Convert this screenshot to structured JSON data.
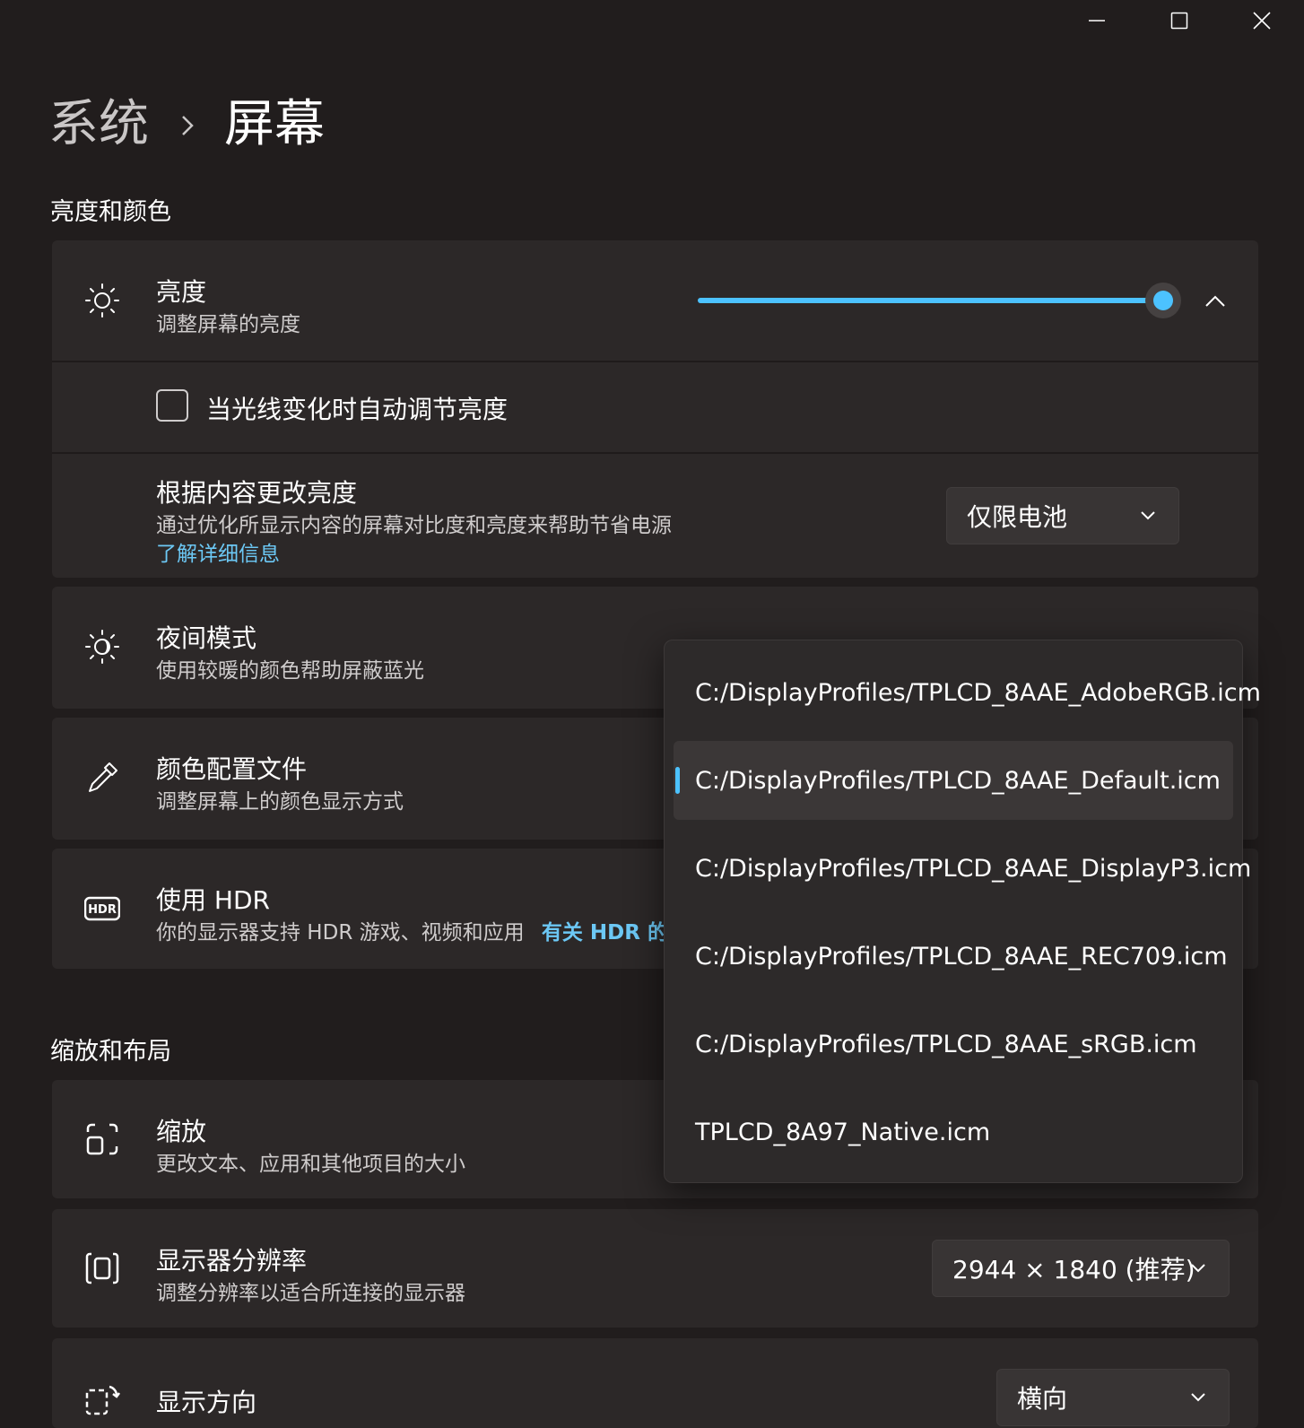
{
  "window": {
    "minimize_icon": "minimize-icon",
    "maximize_icon": "maximize-icon",
    "close_icon": "close-icon"
  },
  "breadcrumb": {
    "parent": "系统",
    "separator_icon": "chevron-right-icon",
    "current": "屏幕"
  },
  "sections": {
    "brightness_color": "亮度和颜色",
    "scale_layout": "缩放和布局"
  },
  "brightness": {
    "icon": "sun-icon",
    "title": "亮度",
    "description": "调整屏幕的亮度",
    "slider_level_percent": 100,
    "expand_icon": "chevron-up-icon",
    "auto_adjust_label": "当光线变化时自动调节亮度",
    "auto_adjust_checked": false
  },
  "content_brightness": {
    "title": "根据内容更改亮度",
    "description": "通过优化所显示内容的屏幕对比度和亮度来帮助节省电源",
    "link": "了解详细信息",
    "selected": "仅限电池"
  },
  "night_mode": {
    "icon": "night-light-icon",
    "title": "夜间模式",
    "description": "使用较暖的颜色帮助屏蔽蓝光"
  },
  "color_profile": {
    "icon": "eyedropper-icon",
    "title": "颜色配置文件",
    "description": "调整屏幕上的颜色显示方式"
  },
  "hdr": {
    "icon": "hdr-icon",
    "title": "使用 HDR",
    "description": "你的显示器支持 HDR 游戏、视频和应用",
    "link": "有关 HDR 的"
  },
  "scale": {
    "icon": "scale-icon",
    "title": "缩放",
    "description": "更改文本、应用和其他项目的大小"
  },
  "resolution": {
    "icon": "resolution-icon",
    "title": "显示器分辨率",
    "description": "调整分辨率以适合所连接的显示器",
    "selected": "2944 × 1840 (推荐)"
  },
  "orientation": {
    "icon": "orientation-icon",
    "title": "显示方向",
    "selected": "横向"
  },
  "profile_menu": {
    "items": [
      "C:/DisplayProfiles/TPLCD_8AAE_AdobeRGB.icm",
      "C:/DisplayProfiles/TPLCD_8AAE_Default.icm",
      "C:/DisplayProfiles/TPLCD_8AAE_DisplayP3.icm",
      "C:/DisplayProfiles/TPLCD_8AAE_REC709.icm",
      "C:/DisplayProfiles/TPLCD_8AAE_sRGB.icm",
      "TPLCD_8A97_Native.icm"
    ],
    "selected_index": 1
  },
  "colors": {
    "accent": "#4cc2ff",
    "link": "#6cc8f5",
    "background": "#211d1d",
    "card": "#2c2828"
  }
}
